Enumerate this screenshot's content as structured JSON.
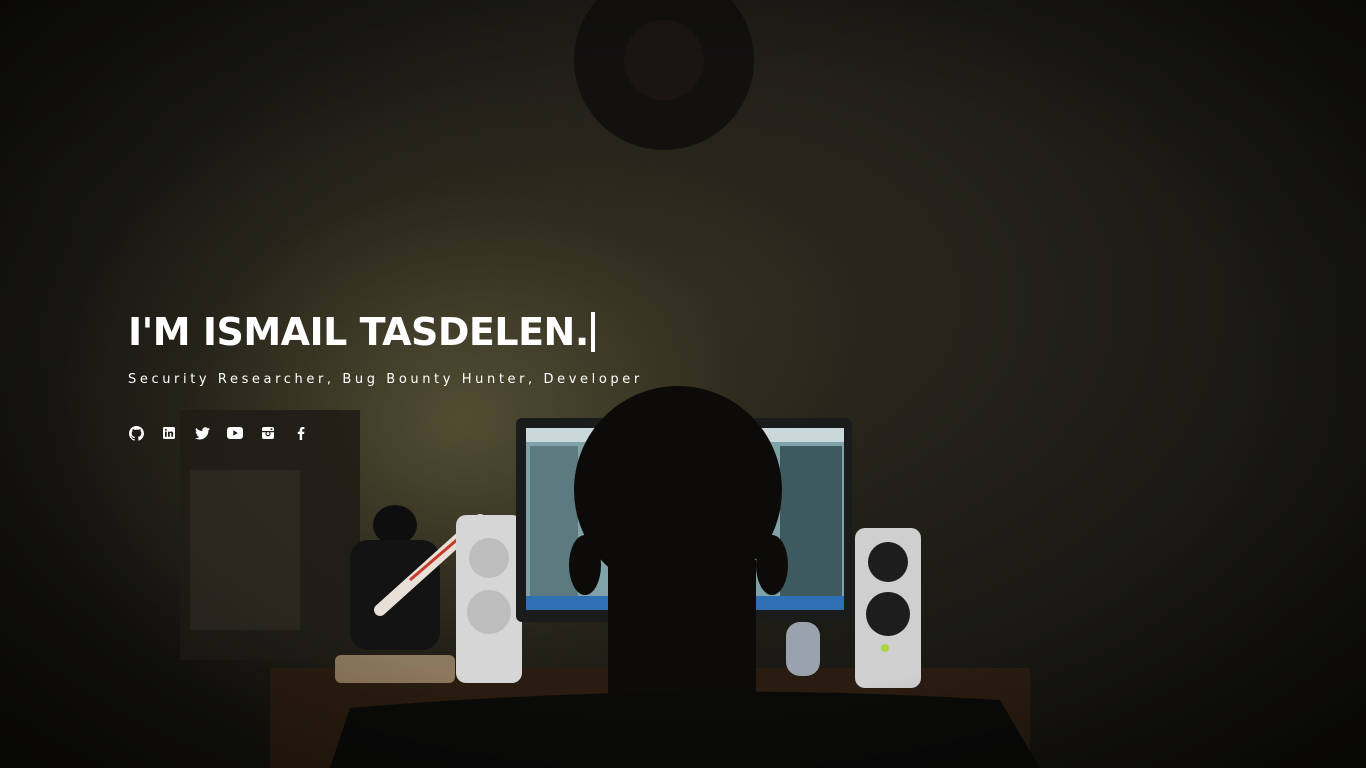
{
  "hero": {
    "title": "I'M ISMAIL TASDELEN.",
    "subtitle": "Security Researcher, Bug Bounty Hunter, Developer"
  },
  "socials": [
    {
      "icon": "github-icon"
    },
    {
      "icon": "linkedin-icon"
    },
    {
      "icon": "twitter-icon"
    },
    {
      "icon": "youtube-icon"
    },
    {
      "icon": "instagram-icon"
    },
    {
      "icon": "facebook-icon"
    }
  ],
  "colors": {
    "text": "#ffffff",
    "background": "#1b1a14"
  }
}
